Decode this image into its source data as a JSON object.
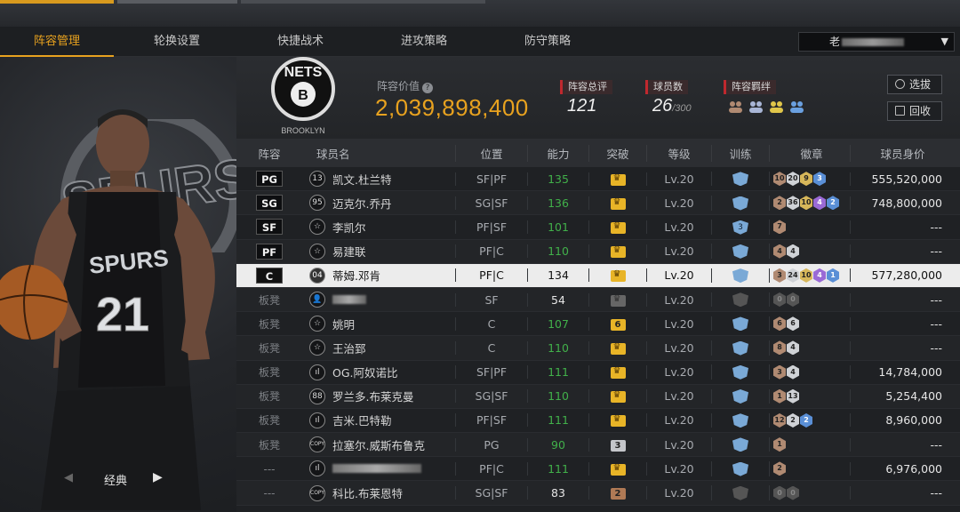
{
  "nav": {
    "tabs": [
      {
        "label": "阵容管理",
        "active": true
      },
      {
        "label": "轮换设置"
      },
      {
        "label": "快捷战术"
      },
      {
        "label": "进攻策略"
      },
      {
        "label": "防守策略"
      }
    ],
    "user_prefix": "老"
  },
  "left_panel": {
    "mode_label": "经典",
    "jersey_team": "SPURS",
    "jersey_number": "21"
  },
  "header": {
    "team_logo_text": "NETS",
    "team_logo_sub": "BROOKLYN",
    "value_label": "阵容价值",
    "value": "2,039,898,400",
    "rating_label": "阵容总评",
    "rating": "121",
    "players_label": "球员数",
    "players": "26",
    "players_max": "/300",
    "chem_label": "阵容羁绊",
    "select_button": "选拔",
    "recycle_button": "回收"
  },
  "table": {
    "headers": {
      "pos": "阵容",
      "name": "球员名",
      "position": "位置",
      "ability": "能力",
      "break": "突破",
      "level": "等级",
      "train": "训练",
      "badges": "徽章",
      "worth": "球员身价"
    },
    "rows": [
      {
        "slot": "PG",
        "icon": "13",
        "name": "凯文.杜兰特",
        "position": "SF|PF",
        "ability": "135",
        "break": "crown",
        "level": "Lv.20",
        "train": "",
        "badges": [
          [
            "10",
            "bronze"
          ],
          [
            "20",
            "silver"
          ],
          [
            "9",
            "gold"
          ],
          [
            "3",
            "blue"
          ]
        ],
        "worth": "555,520,000"
      },
      {
        "slot": "SG",
        "icon": "95",
        "name": "迈克尔.乔丹",
        "position": "SG|SF",
        "ability": "136",
        "break": "crown",
        "level": "Lv.20",
        "train": "",
        "badges": [
          [
            "2",
            "bronze"
          ],
          [
            "36",
            "silver"
          ],
          [
            "10",
            "gold"
          ],
          [
            "4",
            "purple"
          ],
          [
            "2",
            "blue"
          ]
        ],
        "worth": "748,800,000"
      },
      {
        "slot": "SF",
        "icon": "☆",
        "name": "李凯尔",
        "position": "PF|SF",
        "ability": "101",
        "break": "crown",
        "level": "Lv.20",
        "train": "3",
        "badges": [
          [
            "7",
            "bronze"
          ]
        ],
        "worth": "---"
      },
      {
        "slot": "PF",
        "icon": "☆",
        "name": "易建联",
        "position": "PF|C",
        "ability": "110",
        "break": "crown",
        "level": "Lv.20",
        "train": "",
        "badges": [
          [
            "4",
            "bronze"
          ],
          [
            "4",
            "silver"
          ]
        ],
        "worth": "---"
      },
      {
        "slot": "C",
        "icon": "04",
        "name": "蒂姆.邓肯",
        "position": "PF|C",
        "ability": "134",
        "break": "crown",
        "level": "Lv.20",
        "train": "",
        "badges": [
          [
            "3",
            "bronze"
          ],
          [
            "24",
            "silver"
          ],
          [
            "10",
            "gold"
          ],
          [
            "4",
            "purple"
          ],
          [
            "1",
            "blue"
          ]
        ],
        "worth": "577,280,000",
        "selected": true
      },
      {
        "slot": "板凳",
        "icon": "👤",
        "name": "",
        "position": "SF",
        "ability": "54",
        "break": "gray",
        "level": "Lv.20",
        "train": "gray",
        "badges": [
          [
            "0",
            "gray"
          ],
          [
            "0",
            "gray"
          ]
        ],
        "worth": "---",
        "name_hidden": true
      },
      {
        "slot": "板凳",
        "icon": "☆",
        "name": "姚明",
        "position": "C",
        "ability": "107",
        "break": "6",
        "level": "Lv.20",
        "train": "",
        "badges": [
          [
            "6",
            "bronze"
          ],
          [
            "6",
            "silver"
          ]
        ],
        "worth": "---"
      },
      {
        "slot": "板凳",
        "icon": "☆",
        "name": "王治郅",
        "position": "C",
        "ability": "110",
        "break": "crown",
        "level": "Lv.20",
        "train": "",
        "badges": [
          [
            "8",
            "bronze"
          ],
          [
            "4",
            "silver"
          ]
        ],
        "worth": "---"
      },
      {
        "slot": "板凳",
        "icon": "ıl",
        "name": "OG.阿奴诺比",
        "position": "SF|PF",
        "ability": "111",
        "break": "crown",
        "level": "Lv.20",
        "train": "",
        "badges": [
          [
            "3",
            "bronze"
          ],
          [
            "4",
            "silver"
          ]
        ],
        "worth": "14,784,000"
      },
      {
        "slot": "板凳",
        "icon": "88",
        "name": "罗兰多.布莱克曼",
        "position": "SG|SF",
        "ability": "110",
        "break": "crown",
        "level": "Lv.20",
        "train": "",
        "badges": [
          [
            "1",
            "bronze"
          ],
          [
            "13",
            "silver"
          ]
        ],
        "worth": "5,254,400"
      },
      {
        "slot": "板凳",
        "icon": "ıl",
        "name": "吉米.巴特勒",
        "position": "PF|SF",
        "ability": "111",
        "break": "crown",
        "level": "Lv.20",
        "train": "",
        "badges": [
          [
            "12",
            "bronze"
          ],
          [
            "2",
            "silver"
          ],
          [
            "2",
            "blue"
          ]
        ],
        "worth": "8,960,000"
      },
      {
        "slot": "板凳",
        "icon": "COPY",
        "name": "拉塞尔.威斯布鲁克",
        "position": "PG",
        "ability": "90",
        "break": "3",
        "level": "Lv.20",
        "train": "",
        "badges": [
          [
            "1",
            "bronze"
          ]
        ],
        "worth": "---"
      },
      {
        "slot": "---",
        "icon": "ıl",
        "name": "",
        "position": "PF|C",
        "ability": "111",
        "break": "crown",
        "level": "Lv.20",
        "train": "",
        "badges": [
          [
            "2",
            "bronze"
          ]
        ],
        "worth": "6,976,000",
        "name_hidden": true
      },
      {
        "slot": "---",
        "icon": "COPY",
        "name": "科比.布莱恩特",
        "position": "SG|SF",
        "ability": "83",
        "break": "2",
        "level": "Lv.20",
        "train": "gray",
        "badges": [
          [
            "0",
            "gray"
          ],
          [
            "0",
            "gray"
          ]
        ],
        "worth": "---"
      }
    ]
  },
  "colors": {
    "accent": "#e8a21f",
    "ability_green": "#41b04a",
    "tag_red": "#c0282e"
  }
}
